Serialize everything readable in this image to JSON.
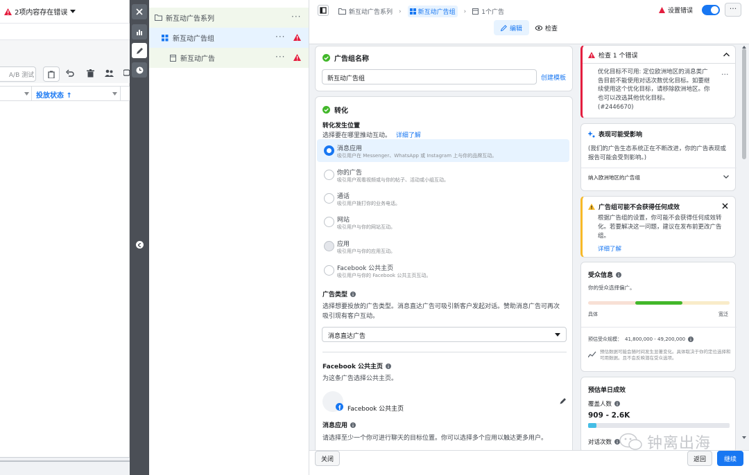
{
  "left": {
    "error_summary": "2项内容存在错误",
    "ab_test": "A/B 测试",
    "column_delivery": "投放状态 ↑"
  },
  "tree": {
    "campaign": "新互动广告系列",
    "adset": "新互动广告组",
    "ad": "新互动广告"
  },
  "header": {
    "crumbs": [
      "新互动广告系列",
      "新互动广告组",
      "1个广告"
    ],
    "settings_error": "设置错误",
    "tab_edit": "编辑",
    "tab_review": "检查"
  },
  "adset_name": {
    "title": "广告组名称",
    "value": "新互动广告组",
    "create_template": "创建模板"
  },
  "conversion": {
    "title": "转化",
    "location_title": "转化发生位置",
    "location_desc": "选择要在哪里推动互动。",
    "learn_more": "详细了解",
    "options": [
      {
        "label": "消息应用",
        "desc": "吸引用户在 Messenger、WhatsApp 或 Instagram 上与你的品牌互动。"
      },
      {
        "label": "你的广告",
        "desc": "吸引用户观看视频或与你的帖子、活动或小组互动。"
      },
      {
        "label": "通话",
        "desc": "吸引用户拨打你的业务电话。"
      },
      {
        "label": "网站",
        "desc": "吸引用户与你的网站互动。"
      },
      {
        "label": "应用",
        "desc": "吸引用户与你的应用互动。"
      },
      {
        "label": "Facebook 公共主页",
        "desc": "吸引用户与你的 Facebook 公共主页互动。"
      }
    ],
    "ad_type_title": "广告类型",
    "ad_type_desc": "选择想要投放的广告类型。消息直达广告可吸引新客户发起对话。赞助消息广告可再次吸引现有客户互动。",
    "ad_type_value": "消息直达广告",
    "fb_page_title": "Facebook 公共主页",
    "fb_page_desc": "为这条广告选择公共主页。",
    "fb_page_value": "Facebook 公共主页",
    "messaging_title": "消息应用",
    "messaging_desc": "请选择至少一个你可进行聊天的目标位置。你可以选择多个应用以触达更多用户。"
  },
  "right": {
    "review_title": "检查 1 个错误",
    "review_text": "优化目标不可用: 定位欧洲地区的消息类广告目前不能使用对话次数优化目标。如要继续使用这个优化目标，请移除欧洲地区。你也可以改选其他优化目标。",
    "review_code": "(#2446670)",
    "perf_title": "表现可能受影响",
    "perf_text": "(我们的广告生态系统正在不断改进，你的广告表现或报告可能会受到影响。)",
    "perf_link": "纳入欧洲地区的广告组",
    "warn_title": "广告组可能不会获得任何成效",
    "warn_text": "根据广告组的设置，你可能不会获得任何成效转化。若要解决这一问题，建议在发布前更改广告组。",
    "warn_link": "详细了解",
    "audience_title": "受众信息",
    "audience_desc": "你的受众选择偏广。",
    "specific": "具体",
    "broad": "宽泛",
    "audience_size_label": "预估受众规模：",
    "audience_size": "41,800,000 - 49,200,000",
    "audience_note": "预估数据可能会随时间发生显著变化。具体取决于你的定位选择和可用数据。且不会反映潜在受众选项。",
    "daily_title": "预估单日成效",
    "reach_label": "覆盖人数",
    "reach_value": "909 - 2.6K",
    "reach_fill": 0.06,
    "conversations_label": "对话次数"
  },
  "footer": {
    "close": "关闭",
    "back": "返回",
    "continue": "继续"
  },
  "watermark": "钟离出海",
  "colors": {
    "accent": "#1877f2",
    "error": "#e41e3f",
    "warning": "#f7b928",
    "success": "#42b72a"
  }
}
